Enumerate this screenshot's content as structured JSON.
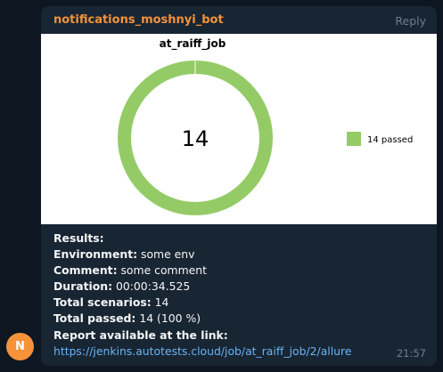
{
  "avatar": {
    "initial": "N",
    "color": "#f5923a"
  },
  "message": {
    "sender": "notifications_moshnyi_bot",
    "reply_label": "Reply",
    "time": "21:57",
    "bubble_color": "#182533"
  },
  "chart_data": {
    "type": "pie",
    "title": "at_raiff_job",
    "center_label": "14",
    "slices": [
      {
        "label": "14 passed",
        "value": 14,
        "color": "#94cb66"
      }
    ],
    "legend_position": "right"
  },
  "details": {
    "results_label": "Results:",
    "environment_label": "Environment:",
    "environment_value": " some env",
    "comment_label": "Comment:",
    "comment_value": " some comment",
    "duration_label": "Duration:",
    "duration_value": " 00:00:34.525",
    "total_scenarios_label": "Total scenarios:",
    "total_scenarios_value": " 14",
    "total_passed_label": "Total passed:",
    "total_passed_value": " 14 (100 %)",
    "report_label": "Report available at the link:",
    "report_link": "https://jenkins.autotests.cloud/job/at_raiff_job/2/allure"
  }
}
